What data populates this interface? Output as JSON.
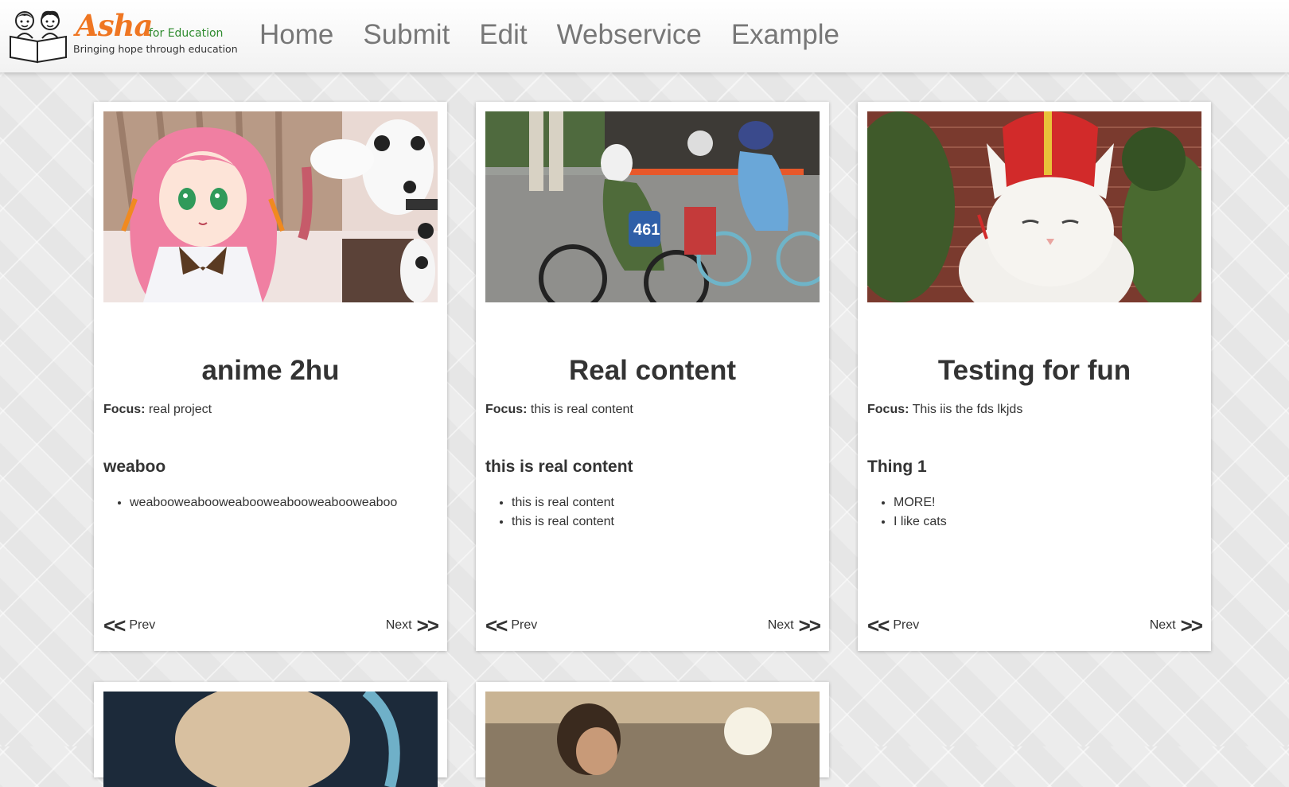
{
  "logo": {
    "word": "Asha",
    "suffix": "for Education",
    "tagline": "Bringing hope through education",
    "alt": "Asha for Education logo"
  },
  "nav": {
    "home": "Home",
    "submit": "Submit",
    "edit": "Edit",
    "webservice": "Webservice",
    "example": "Example"
  },
  "pager": {
    "prev_arrow": "<<",
    "prev": "Prev",
    "next": "Next",
    "next_arrow": ">>"
  },
  "focus_label": "Focus:",
  "cards": [
    {
      "title": "anime 2hu",
      "focus": "real project",
      "subhead": "weaboo",
      "items": [
        "weabooweabooweabooweabooweabooweaboo"
      ],
      "image": "anime-girl-and-dalmatian-photo"
    },
    {
      "title": "Real content",
      "focus": "this is real content",
      "subhead": "this is real content",
      "items": [
        "this is real content",
        "this is real content"
      ],
      "image": "kids-bicycle-race-photo"
    },
    {
      "title": "Testing for fun",
      "focus": "This iis the fds lkjds",
      "subhead": "Thing 1",
      "items": [
        "MORE!",
        "I like cats"
      ],
      "image": "white-cat-with-red-hat-photo"
    }
  ],
  "colors": {
    "logo_orange": "#ef7622",
    "logo_green": "#2e8b2e",
    "nav_text": "#777777",
    "body_text": "#333333",
    "card_bg": "#ffffff",
    "page_bg": "#ececec"
  }
}
